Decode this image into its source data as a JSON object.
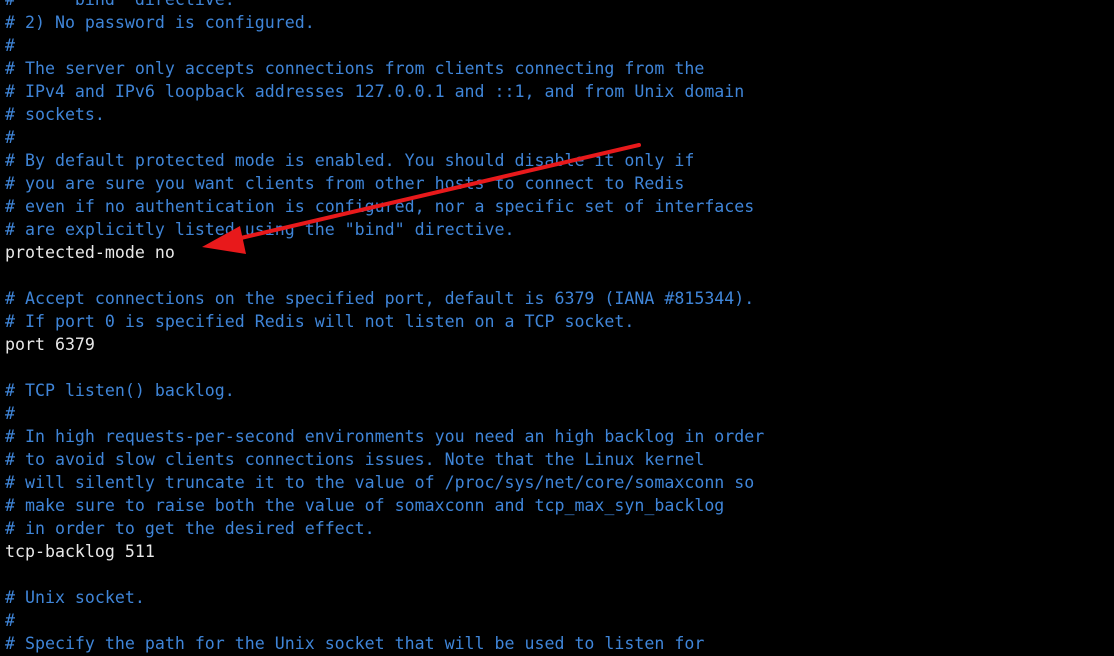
{
  "terminal": {
    "lines": [
      {
        "text": "#     \"bind\" directive.",
        "kind": "comment"
      },
      {
        "text": "# 2) No password is configured.",
        "kind": "comment"
      },
      {
        "text": "#",
        "kind": "comment"
      },
      {
        "text": "# The server only accepts connections from clients connecting from the",
        "kind": "comment"
      },
      {
        "text": "# IPv4 and IPv6 loopback addresses 127.0.0.1 and ::1, and from Unix domain",
        "kind": "comment"
      },
      {
        "text": "# sockets.",
        "kind": "comment"
      },
      {
        "text": "#",
        "kind": "comment"
      },
      {
        "text": "# By default protected mode is enabled. You should disable it only if",
        "kind": "comment"
      },
      {
        "text": "# you are sure you want clients from other hosts to connect to Redis",
        "kind": "comment"
      },
      {
        "text": "# even if no authentication is configured, nor a specific set of interfaces",
        "kind": "comment"
      },
      {
        "text": "# are explicitly listed using the \"bind\" directive.",
        "kind": "comment"
      },
      {
        "text": "protected-mode no",
        "kind": "directive"
      },
      {
        "text": "",
        "kind": "blank"
      },
      {
        "text": "# Accept connections on the specified port, default is 6379 (IANA #815344).",
        "kind": "comment"
      },
      {
        "text": "# If port 0 is specified Redis will not listen on a TCP socket.",
        "kind": "comment"
      },
      {
        "text": "port 6379",
        "kind": "directive"
      },
      {
        "text": "",
        "kind": "blank"
      },
      {
        "text": "# TCP listen() backlog.",
        "kind": "comment"
      },
      {
        "text": "#",
        "kind": "comment"
      },
      {
        "text": "# In high requests-per-second environments you need an high backlog in order",
        "kind": "comment"
      },
      {
        "text": "# to avoid slow clients connections issues. Note that the Linux kernel",
        "kind": "comment"
      },
      {
        "text": "# will silently truncate it to the value of /proc/sys/net/core/somaxconn so",
        "kind": "comment"
      },
      {
        "text": "# make sure to raise both the value of somaxconn and tcp_max_syn_backlog",
        "kind": "comment"
      },
      {
        "text": "# in order to get the desired effect.",
        "kind": "comment"
      },
      {
        "text": "tcp-backlog 511",
        "kind": "directive"
      },
      {
        "text": "",
        "kind": "blank"
      },
      {
        "text": "# Unix socket.",
        "kind": "comment"
      },
      {
        "text": "#",
        "kind": "comment"
      },
      {
        "text": "# Specify the path for the Unix socket that will be used to listen for",
        "kind": "comment"
      }
    ]
  },
  "colors": {
    "background": "#000000",
    "comment": "#3f85d8",
    "directive": "#e8e8e8",
    "annotation_arrow": "#e8191b"
  },
  "annotation": {
    "icon": "red-arrow-icon",
    "target_line": "protected-mode no"
  }
}
